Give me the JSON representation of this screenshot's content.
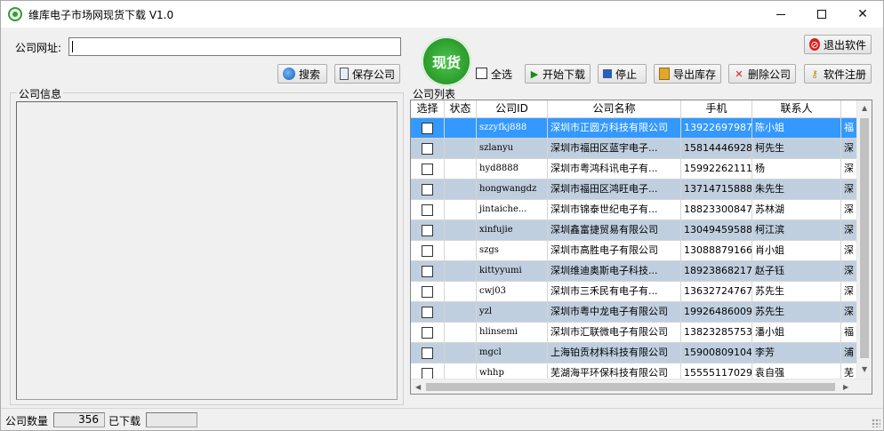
{
  "window": {
    "title": "维库电子市场网现货下载 V1.0",
    "min_label": "",
    "max_label": "",
    "close_label": "✕"
  },
  "form": {
    "url_label": "公司网址:",
    "url_value": "",
    "search_label": "搜索",
    "save_company_label": "保存公司"
  },
  "badge": {
    "text": "现货"
  },
  "toolbar": {
    "select_all_label": "全选",
    "start_download_label": "开始下载",
    "stop_label": "停止",
    "export_label": "导出库存",
    "delete_company_label": "删除公司",
    "register_label": "软件注册",
    "exit_label": "退出软件"
  },
  "info_group": {
    "title": "公司信息"
  },
  "list_group": {
    "title": "公司列表"
  },
  "table": {
    "headers": [
      "选择",
      "状态",
      "公司ID",
      "公司名称",
      "手机",
      "联系人",
      ""
    ],
    "rows": [
      {
        "id": "szzyfkj888",
        "name": "深圳市正圆方科技有限公司",
        "phone": "13922697987",
        "contact": "陈小姐",
        "extra": "福"
      },
      {
        "id": "szlanyu",
        "name": "深圳市福田区蓝宇电子...",
        "phone": "15814446928",
        "contact": "柯先生",
        "extra": "深"
      },
      {
        "id": "hyd8888",
        "name": "深圳市粤鸿科讯电子有...",
        "phone": "15992262111",
        "contact": "杨",
        "extra": "深"
      },
      {
        "id": "hongwangdz",
        "name": "深圳市福田区鸿旺电子...",
        "phone": "13714715888",
        "contact": "朱先生",
        "extra": "深"
      },
      {
        "id": "jintaiche...",
        "name": "深圳市锦泰世纪电子有...",
        "phone": "18823300847",
        "contact": "苏林湖",
        "extra": "深"
      },
      {
        "id": "xinfujie",
        "name": "深圳鑫富捷贸易有限公司",
        "phone": "13049459588",
        "contact": "柯江滨",
        "extra": "深"
      },
      {
        "id": "szgs",
        "name": "深圳市高胜电子有限公司",
        "phone": "13088879166",
        "contact": "肖小姐",
        "extra": "深"
      },
      {
        "id": "kittyyumi",
        "name": "深圳维迪奥斯电子科技...",
        "phone": "18923868217",
        "contact": "赵子钰",
        "extra": "深"
      },
      {
        "id": "cwj03",
        "name": "深圳市三禾民有电子有...",
        "phone": "13632724767",
        "contact": "苏先生",
        "extra": "深"
      },
      {
        "id": "yzl",
        "name": "深圳市粤中龙电子有限公司",
        "phone": "19926486009",
        "contact": "苏先生",
        "extra": "深"
      },
      {
        "id": "hlinsemi",
        "name": "深圳市汇联微电子有限公司",
        "phone": "13823285753",
        "contact": "潘小姐",
        "extra": "福"
      },
      {
        "id": "mgcl",
        "name": "上海铂贡材料科技有限公司",
        "phone": "15900809104",
        "contact": "李芳",
        "extra": "浦"
      },
      {
        "id": "whhp",
        "name": "芜湖海平环保科技有限公司",
        "phone": "15555117029",
        "contact": "袁自强",
        "extra": "芜"
      }
    ]
  },
  "status": {
    "count_label": "公司数量",
    "count_value": "356",
    "downloaded_label": "已下载",
    "downloaded_value": ""
  }
}
